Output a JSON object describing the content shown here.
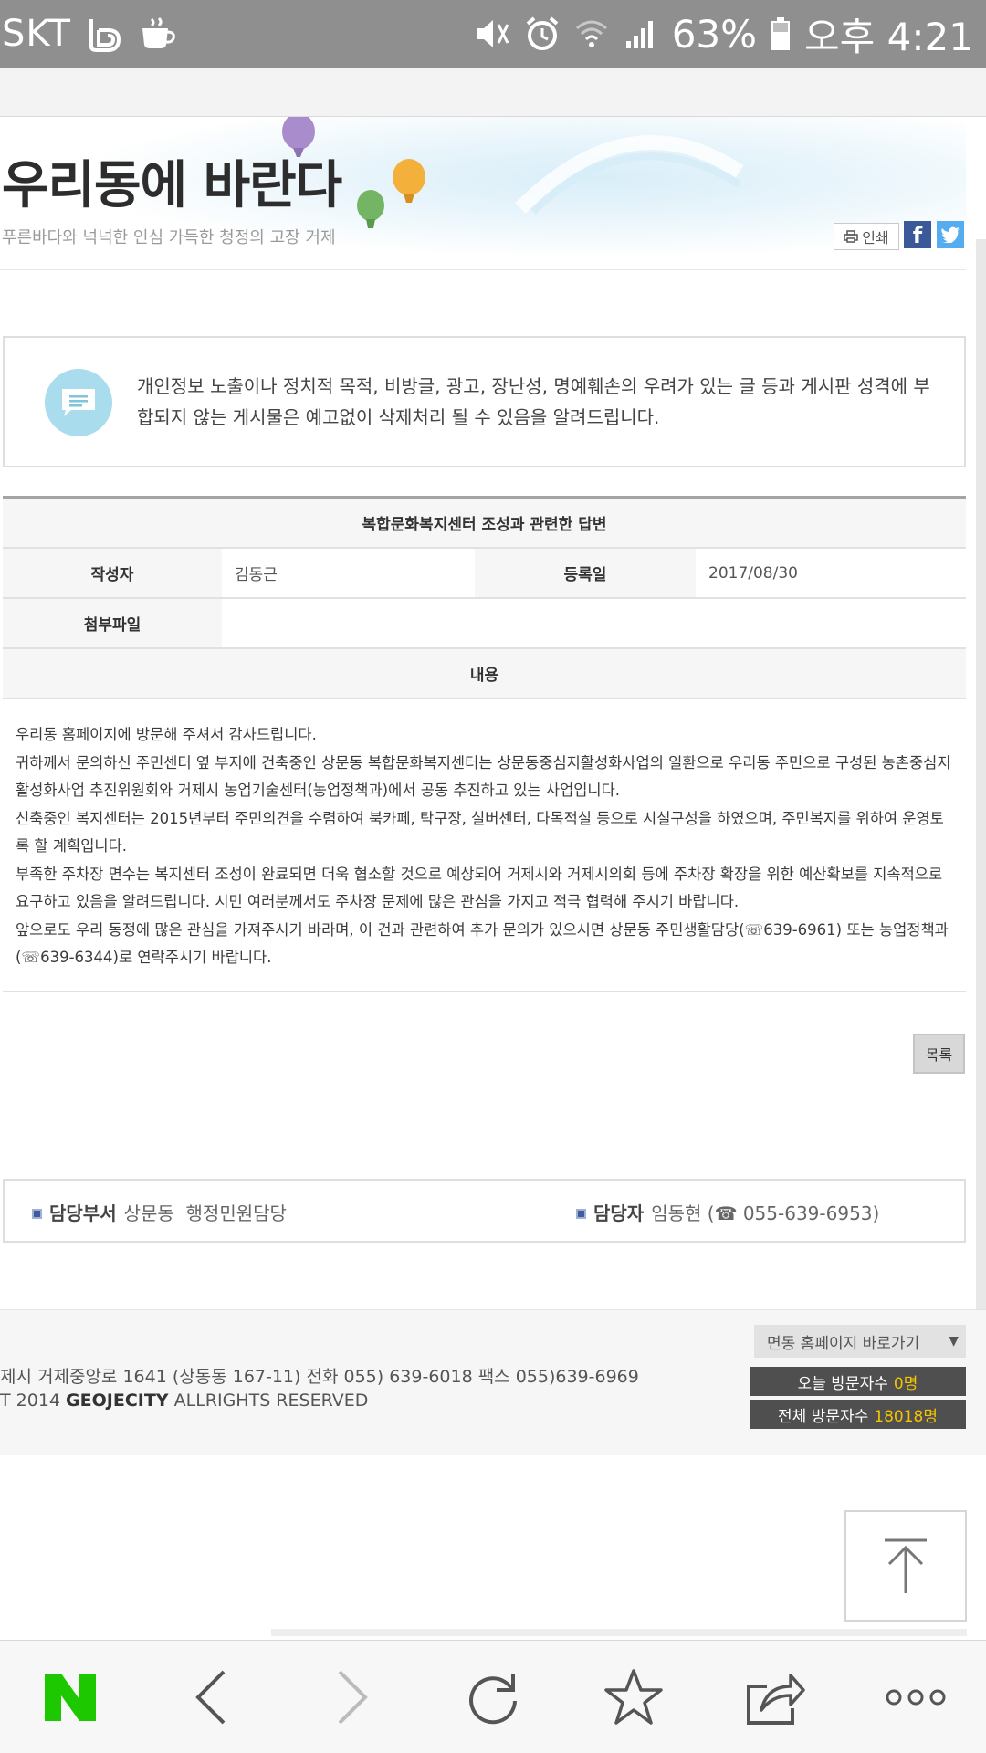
{
  "status_bar": {
    "carrier": "SKT",
    "battery": "63%",
    "time": "오후 4:21"
  },
  "header": {
    "title": "우리동에 바란다",
    "subtitle": "푸른바다와 넉넉한 인심 가득한 청정의 고장 거제",
    "print_label": "인쇄"
  },
  "notice": {
    "text": "개인정보 노출이나 정치적 목적, 비방글, 광고, 장난성, 명예훼손의 우려가 있는 글 등과 게시판 성격에 부합되지 않는 게시물은 예고없이 삭제처리 될 수 있음을 알려드립니다."
  },
  "post": {
    "title": "복합문화복지센터 조성과 관련한 답변",
    "author_label": "작성자",
    "author": "김동근",
    "date_label": "등록일",
    "date": "2017/08/30",
    "attachment_label": "첨부파일",
    "content_label": "내용",
    "content": [
      "우리동 홈페이지에 방문해 주셔서 감사드립니다.",
      "귀하께서 문의하신 주민센터 옆 부지에 건축중인 상문동 복합문화복지센터는 상문동중심지활성화사업의 일환으로 우리동 주민으로 구성된 농촌중심지 활성화사업 추진위원회와 거제시 농업기술센터(농업정책과)에서 공동 추진하고 있는 사업입니다.",
      "신축중인 복지센터는 2015년부터 주민의견을 수렴하여 북카페, 탁구장, 실버센터, 다목적실 등으로 시설구성을 하였으며, 주민복지를 위하여 운영토록 할 계획입니다.",
      "부족한 주차장 면수는 복지센터 조성이 완료되면 더욱 협소할 것으로 예상되어 거제시와 거제시의회 등에 주차장 확장을 위한 예산확보를 지속적으로 요구하고 있음을 알려드립니다. 시민 여러분께서도 주차장 문제에 많은 관심을 가지고 적극 협력해 주시기 바랍니다.",
      "앞으로도 우리 동정에 많은 관심을 가져주시기 바라며, 이 건과 관련하여 추가 문의가 있으시면 상문동 주민생활담당(☏639-6961) 또는 농업정책과(☏639-6344)로 연락주시기 바랍니다."
    ],
    "list_button": "목록"
  },
  "department": {
    "dept_label": "담당부서",
    "dept_value": "상문동  행정민원담당",
    "person_label": "담당자",
    "person_value": "임동현 (☎ 055-639-6953)"
  },
  "footer": {
    "address": "제시 거제중앙로 1641 (상동동 167-11) 전화 055) 639-6018 팩스 055)639-6969",
    "copyright_prefix": "T 2014",
    "copyright_brand": "GEOJECITY",
    "copyright_suffix": "ALLRIGHTS RESERVED",
    "site_select": "면동 홈페이지 바로가기",
    "today_label": "오늘 방문자수",
    "today_value": "0명",
    "total_label": "전체 방문자수",
    "total_value": "18018명"
  },
  "colors": {
    "naver_green": "#1ec800",
    "visit_highlight": "#f5c400",
    "facebook": "#3b5998",
    "twitter": "#55acee"
  }
}
